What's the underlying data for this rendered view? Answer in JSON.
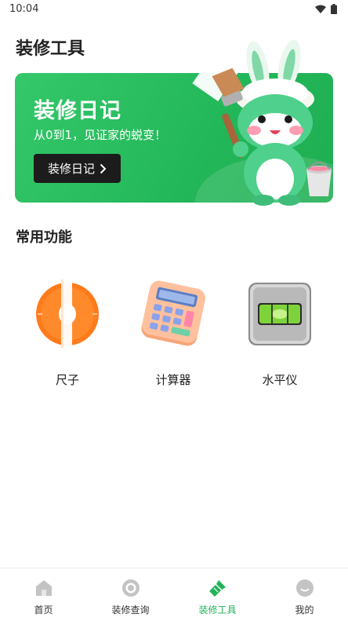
{
  "status_bar": {
    "time": "10:04"
  },
  "page": {
    "title": "装修工具"
  },
  "banner": {
    "title": "装修日记",
    "subtitle": "从0到1，见证家的蜕变！",
    "button_label": "装修日记",
    "accent": "#22b759"
  },
  "section": {
    "title": "常用功能"
  },
  "tools": [
    {
      "label": "尺子",
      "icon": "ruler-icon"
    },
    {
      "label": "计算器",
      "icon": "calculator-icon"
    },
    {
      "label": "水平仪",
      "icon": "level-icon"
    }
  ],
  "nav": [
    {
      "label": "首页",
      "icon": "home-icon",
      "active": false
    },
    {
      "label": "装修查询",
      "icon": "search-circle-icon",
      "active": false
    },
    {
      "label": "装修工具",
      "icon": "brush-icon",
      "active": true
    },
    {
      "label": "我的",
      "icon": "profile-icon",
      "active": false
    }
  ],
  "colors": {
    "active": "#22b35a",
    "inactive": "#c4c4c4"
  }
}
